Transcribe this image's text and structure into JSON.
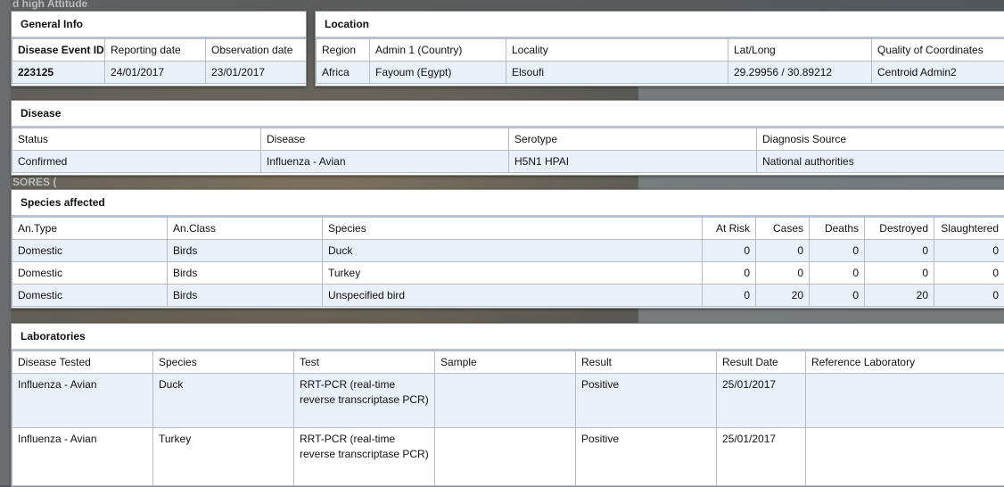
{
  "background": {
    "fragment_top_left": "d high Attitude",
    "fragment_left": "SORES ("
  },
  "general_info": {
    "title": "General Info",
    "headers": [
      "Disease Event ID",
      "Reporting date",
      "Observation date"
    ],
    "row": [
      "223125",
      "24/01/2017",
      "23/01/2017"
    ]
  },
  "location": {
    "title": "Location",
    "headers": [
      "Region",
      "Admin 1 (Country)",
      "Locality",
      "Lat/Long",
      "Quality of Coordinates"
    ],
    "row": [
      "Africa",
      "Fayoum (Egypt)",
      "Elsoufi",
      "29.29956 / 30.89212",
      "Centroid Admin2"
    ]
  },
  "disease": {
    "title": "Disease",
    "headers": [
      "Status",
      "Disease",
      "Serotype",
      "Diagnosis Source"
    ],
    "row": [
      "Confirmed",
      "Influenza - Avian",
      "H5N1 HPAI",
      "National authorities"
    ]
  },
  "species_affected": {
    "title": "Species affected",
    "headers": [
      "An.Type",
      "An.Class",
      "Species",
      "At Risk",
      "Cases",
      "Deaths",
      "Destroyed",
      "Slaughtered"
    ],
    "rows": [
      [
        "Domestic",
        "Birds",
        "Duck",
        "0",
        "0",
        "0",
        "0",
        "0"
      ],
      [
        "Domestic",
        "Birds",
        "Turkey",
        "0",
        "0",
        "0",
        "0",
        "0"
      ],
      [
        "Domestic",
        "Birds",
        "Unspecified bird",
        "0",
        "20",
        "0",
        "20",
        "0"
      ]
    ]
  },
  "laboratories": {
    "title": "Laboratories",
    "headers": [
      "Disease Tested",
      "Species",
      "Test",
      "Sample",
      "Result",
      "Result Date",
      "Reference Laboratory"
    ],
    "rows": [
      [
        "Influenza - Avian",
        "Duck",
        "RRT-PCR (real-time reverse transcriptase PCR)",
        "",
        "Positive",
        "25/01/2017",
        ""
      ],
      [
        "Influenza - Avian",
        "Turkey",
        "RRT-PCR (real-time reverse transcriptase PCR)",
        "",
        "Positive",
        "25/01/2017",
        ""
      ]
    ]
  }
}
